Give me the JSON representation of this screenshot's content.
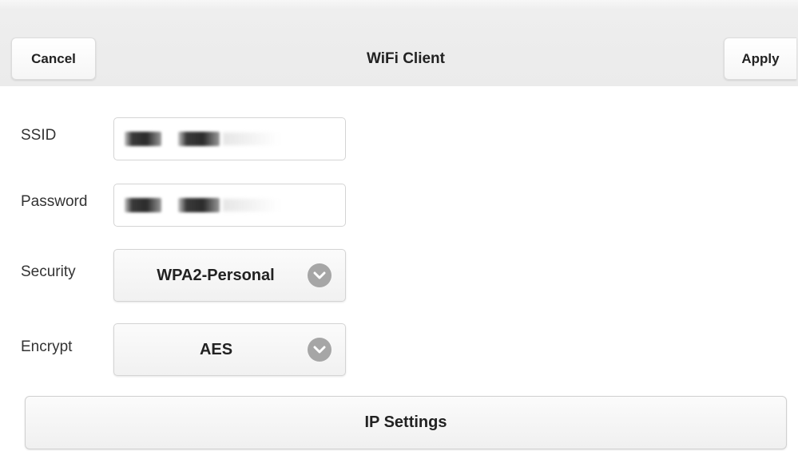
{
  "header": {
    "title": "WiFi Client",
    "cancel_label": "Cancel",
    "apply_label": "Apply"
  },
  "form": {
    "ssid": {
      "label": "SSID"
    },
    "password": {
      "label": "Password"
    },
    "security": {
      "label": "Security",
      "value": "WPA2-Personal",
      "icon": "chevron-down-icon"
    },
    "encrypt": {
      "label": "Encrypt",
      "value": "AES",
      "icon": "chevron-down-icon"
    }
  },
  "ip_settings": {
    "label": "IP Settings"
  },
  "colors": {
    "header_bg": "#ebebeb",
    "chevron_bg": "#a6a6a6",
    "text": "#222222"
  }
}
